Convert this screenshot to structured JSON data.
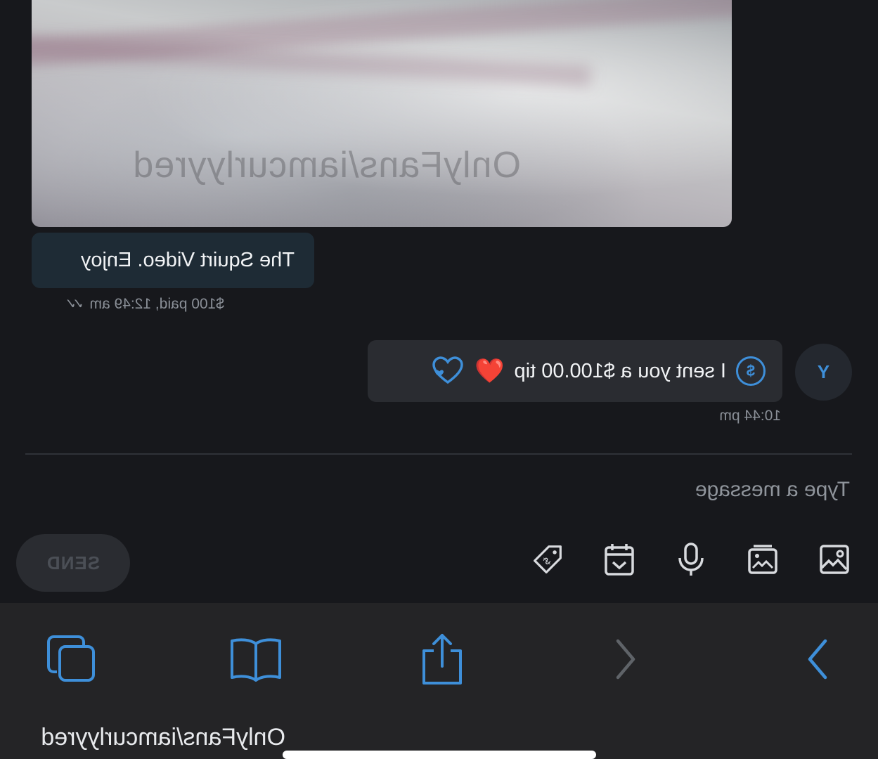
{
  "media": {
    "watermark": "OnlyFans/iamcurlyyred"
  },
  "incoming_message": {
    "text": "The Squirt Video. Enjoy",
    "meta": "$100 paid, 12:49 am"
  },
  "tip_message": {
    "avatar_initial": "Y",
    "text": "I sent you a $100.00 tip",
    "emoji": "❤️",
    "time": "10:44 pm"
  },
  "composer": {
    "placeholder": "Type a message",
    "send_label": "SEND",
    "tools": [
      "image-icon",
      "gallery-icon",
      "microphone-icon",
      "calendar-icon",
      "price-tag-icon"
    ]
  },
  "browser": {
    "url_label": "OnlyFans/iamcurlyyred",
    "nav": [
      "forward-icon",
      "back-icon",
      "share-icon",
      "bookmarks-icon",
      "tabs-icon"
    ],
    "accent": "#3e8fd9"
  }
}
